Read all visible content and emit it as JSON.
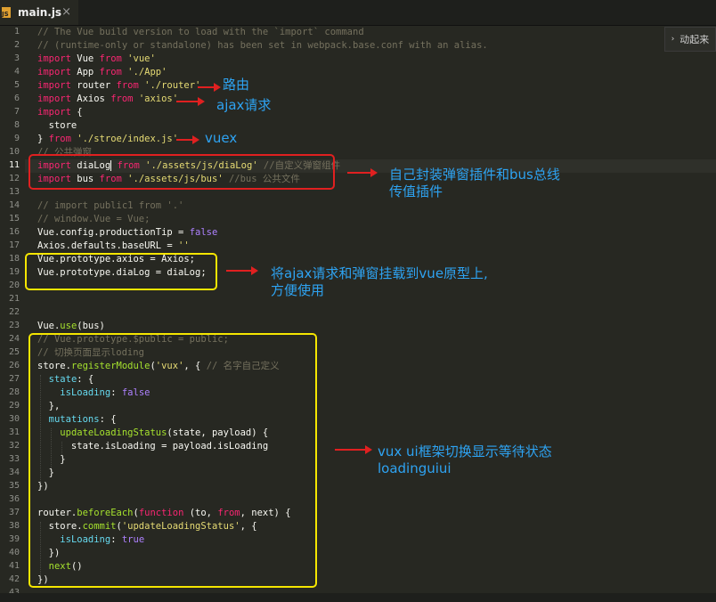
{
  "tab": {
    "title": "main.js",
    "close": "×",
    "icon": "js-file-icon",
    "icon_text": "JS"
  },
  "minimap_button": {
    "label": "动起来",
    "icon": "chevron-right-icon"
  },
  "current_line": 11,
  "lines": [
    "// The Vue build version to load with the `import` command",
    "// (runtime-only or standalone) has been set in webpack.base.conf with an alias.",
    "import Vue from 'vue'",
    "import App from './App'",
    "import router from './router'",
    "import Axios from 'axios'",
    "import {",
    "  store",
    "} from './stroe/index.js'",
    "// 公共弹窗",
    "import diaLog from './assets/js/diaLog' //自定义弹窗组件",
    "import bus from './assets/js/bus' //bus 公共文件",
    "",
    "// import public1 from '.'",
    "// window.Vue = Vue;",
    "Vue.config.productionTip = false",
    "Axios.defaults.baseURL = ''",
    "Vue.prototype.$axios = Axios;",
    "Vue.prototype.$diaLog = diaLog;",
    "",
    "",
    "",
    "Vue.use(bus)",
    "// Vue.prototype.$public = public;",
    "// 切换页面显示loding",
    "store.registerModule('vux', { // 名字自己定义",
    "  state: {",
    "    isLoading: false",
    "  },",
    "  mutations: {",
    "    updateLoadingStatus(state, payload) {",
    "      state.isLoading = payload.isLoading",
    "    }",
    "  }",
    "})",
    "",
    "router.beforeEach(function (to, from, next) {",
    "  store.commit('updateLoadingStatus', {",
    "    isLoading: true",
    "  })",
    "  next()",
    "})",
    ""
  ],
  "annotations": {
    "router": "路由",
    "ajax": "ajax请求",
    "vuex": "vuex",
    "plugins": "自己封装弹窗插件和bus总线\n传值插件",
    "prototype": "将ajax请求和弹窗挂载到vue原型上,\n方便使用",
    "vux": "vux ui框架切换显示等待状态\nloadinguiui"
  },
  "colors": {
    "background": "#272822",
    "comment": "#75715e",
    "keyword": "#f92672",
    "string": "#e6db74",
    "function": "#a6e22e",
    "annotation_text": "#2ea3f2",
    "red_box": "#e02020",
    "yellow_box": "#f5e600"
  }
}
